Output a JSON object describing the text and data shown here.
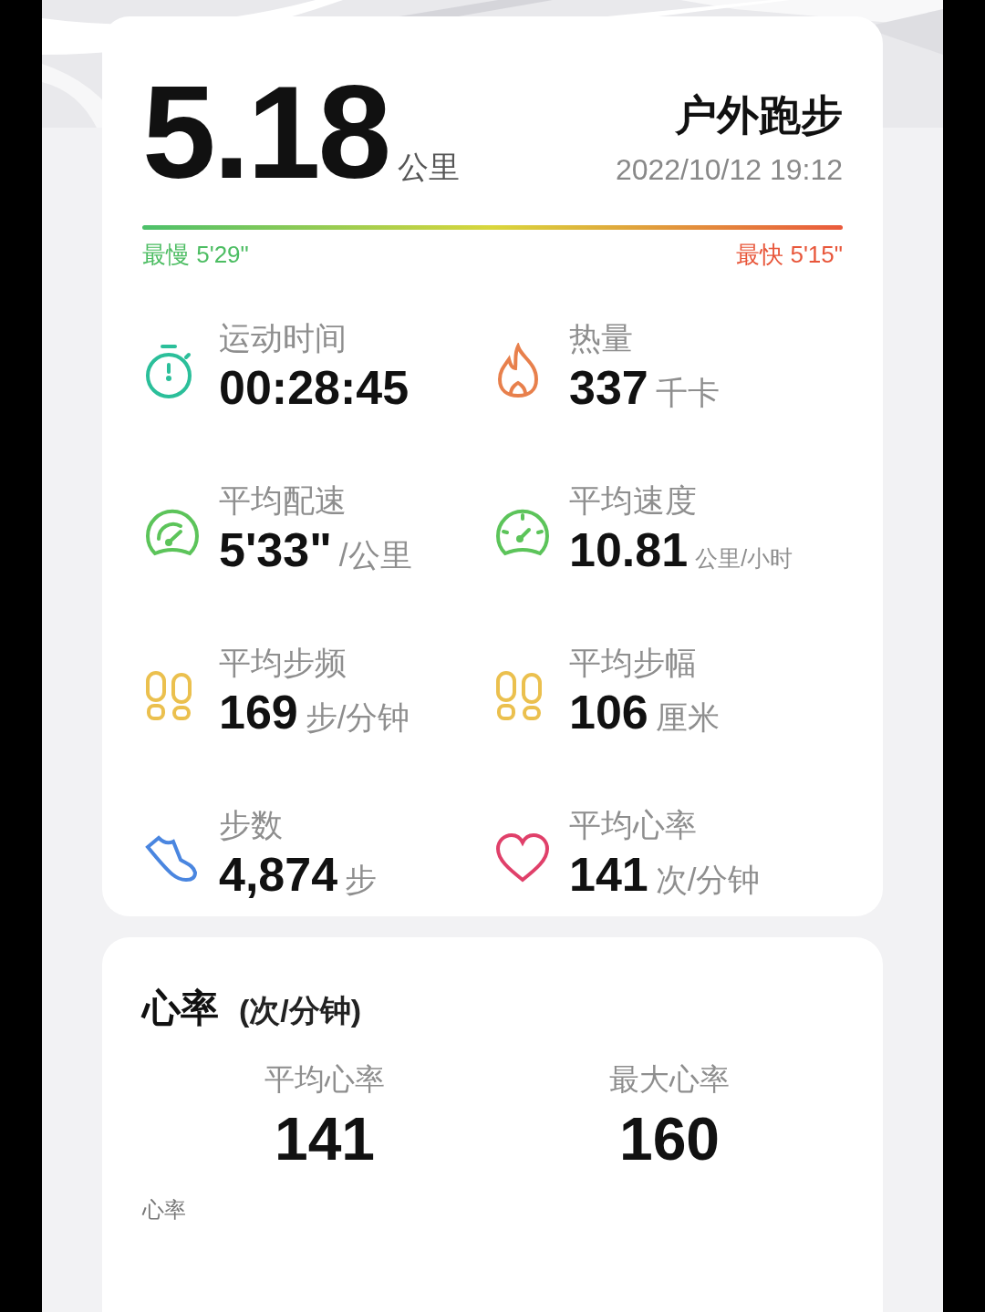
{
  "header": {
    "distance": "5.18",
    "distance_unit": "公里",
    "sport": "户外跑步",
    "datetime": "2022/10/12 19:12"
  },
  "pace_bar": {
    "slowest": "最慢 5'29\"",
    "fastest": "最快 5'15\""
  },
  "stats": [
    {
      "kind": "stopwatch",
      "label": "运动时间",
      "value": "00:28:45",
      "color": "#2bbf9a"
    },
    {
      "kind": "flame",
      "label": "热量",
      "value": "337",
      "unit": "千卡",
      "color": "#e8804c"
    },
    {
      "kind": "gauge",
      "label": "平均配速",
      "value": "5'33\"",
      "unit": "/公里",
      "color": "#5cc45a"
    },
    {
      "kind": "speedometer",
      "label": "平均速度",
      "value": "10.81",
      "unit": "公里/小时",
      "small_unit": true,
      "color": "#5cc45a"
    },
    {
      "kind": "footprints",
      "label": "平均步频",
      "value": "169",
      "unit": "步/分钟",
      "color": "#ebc04e"
    },
    {
      "kind": "footprints",
      "label": "平均步幅",
      "value": "106",
      "unit": "厘米",
      "color": "#ebc04e"
    },
    {
      "kind": "shoe",
      "label": "步数",
      "value": "4,874",
      "unit": "步",
      "color": "#4a86e0"
    },
    {
      "kind": "heart",
      "label": "平均心率",
      "value": "141",
      "unit": "次/分钟",
      "color": "#e0406a"
    }
  ],
  "heart_rate": {
    "title": "心率",
    "unit": "(次/分钟)",
    "summary": [
      {
        "label": "平均心率",
        "value": "141"
      },
      {
        "label": "最大心率",
        "value": "160"
      }
    ],
    "chart_label": "心率"
  }
}
